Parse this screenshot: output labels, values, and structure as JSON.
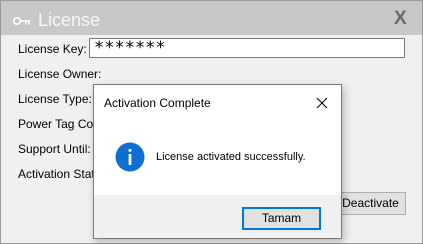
{
  "license_window": {
    "title": "License",
    "close_label": "X",
    "fields": [
      {
        "label": "License Key:",
        "value": "*******"
      },
      {
        "label": "License Owner:"
      },
      {
        "label": "License Type:"
      },
      {
        "label": "Power Tag Count"
      },
      {
        "label": "Support Until:"
      },
      {
        "label": "Activation State"
      }
    ],
    "deactivate_label": "Deactivate"
  },
  "dialog": {
    "title": "Activation Complete",
    "message": "License activated successfully.",
    "ok_label": "Tamam",
    "icon": "info-icon",
    "accent_color": "#0078d7"
  }
}
